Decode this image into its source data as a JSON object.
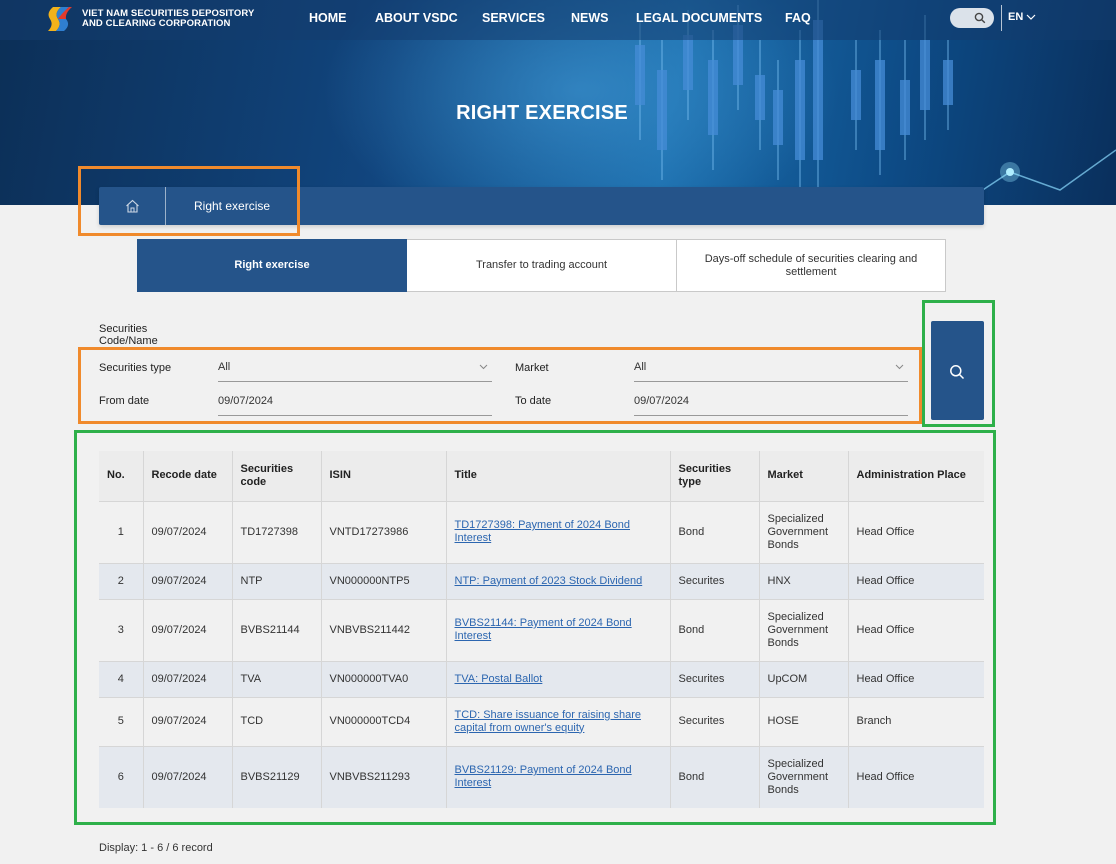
{
  "header": {
    "logo_line1": "VIET NAM SECURITIES DEPOSITORY",
    "logo_line2": "AND CLEARING CORPORATION",
    "nav": [
      "HOME",
      "ABOUT VSDC",
      "SERVICES",
      "NEWS",
      "LEGAL DOCUMENTS",
      "FAQ"
    ],
    "language": "EN"
  },
  "page_title": "RIGHT EXERCISE",
  "breadcrumb": {
    "current": "Right exercise"
  },
  "tabs": [
    {
      "label": "Right exercise",
      "active": true
    },
    {
      "label": "Transfer to trading account",
      "active": false
    },
    {
      "label": "Days-off schedule of securities clearing and settlement",
      "active": false
    }
  ],
  "filters": {
    "code_label": "Securities Code/Name",
    "type_label": "Securities type",
    "type_value": "All",
    "market_label": "Market",
    "market_value": "All",
    "from_label": "From date",
    "from_value": "09/07/2024",
    "to_label": "To date",
    "to_value": "09/07/2024"
  },
  "table": {
    "headers": [
      "No.",
      "Recode date",
      "Securities code",
      "ISIN",
      "Title",
      "Securities type",
      "Market",
      "Administration Place"
    ],
    "rows": [
      {
        "no": "1",
        "date": "09/07/2024",
        "code": "TD1727398",
        "isin": "VNTD17273986",
        "title": "TD1727398: Payment of 2024 Bond Interest",
        "type": "Bond",
        "market": "Specialized Government Bonds",
        "place": "Head Office"
      },
      {
        "no": "2",
        "date": "09/07/2024",
        "code": "NTP",
        "isin": "VN000000NTP5",
        "title": "NTP: Payment of 2023 Stock Dividend",
        "type": "Securites",
        "market": "HNX",
        "place": "Head Office"
      },
      {
        "no": "3",
        "date": "09/07/2024",
        "code": "BVBS21144",
        "isin": "VNBVBS211442",
        "title": "BVBS21144: Payment of 2024 Bond Interest",
        "type": "Bond",
        "market": "Specialized Government Bonds",
        "place": "Head Office"
      },
      {
        "no": "4",
        "date": "09/07/2024",
        "code": "TVA",
        "isin": "VN000000TVA0",
        "title": "TVA: Postal Ballot",
        "type": "Securites",
        "market": "UpCOM",
        "place": "Head Office"
      },
      {
        "no": "5",
        "date": "09/07/2024",
        "code": "TCD",
        "isin": "VN000000TCD4",
        "title": "TCD: Share issuance for raising share capital from owner's equity",
        "type": "Securites",
        "market": "HOSE",
        "place": "Branch"
      },
      {
        "no": "6",
        "date": "09/07/2024",
        "code": "BVBS21129",
        "isin": "VNBVBS211293",
        "title": "BVBS21129: Payment of 2024 Bond Interest",
        "type": "Bond",
        "market": "Specialized Government Bonds",
        "place": "Head Office"
      }
    ]
  },
  "display_info": "Display: 1 - 6 / 6 record"
}
